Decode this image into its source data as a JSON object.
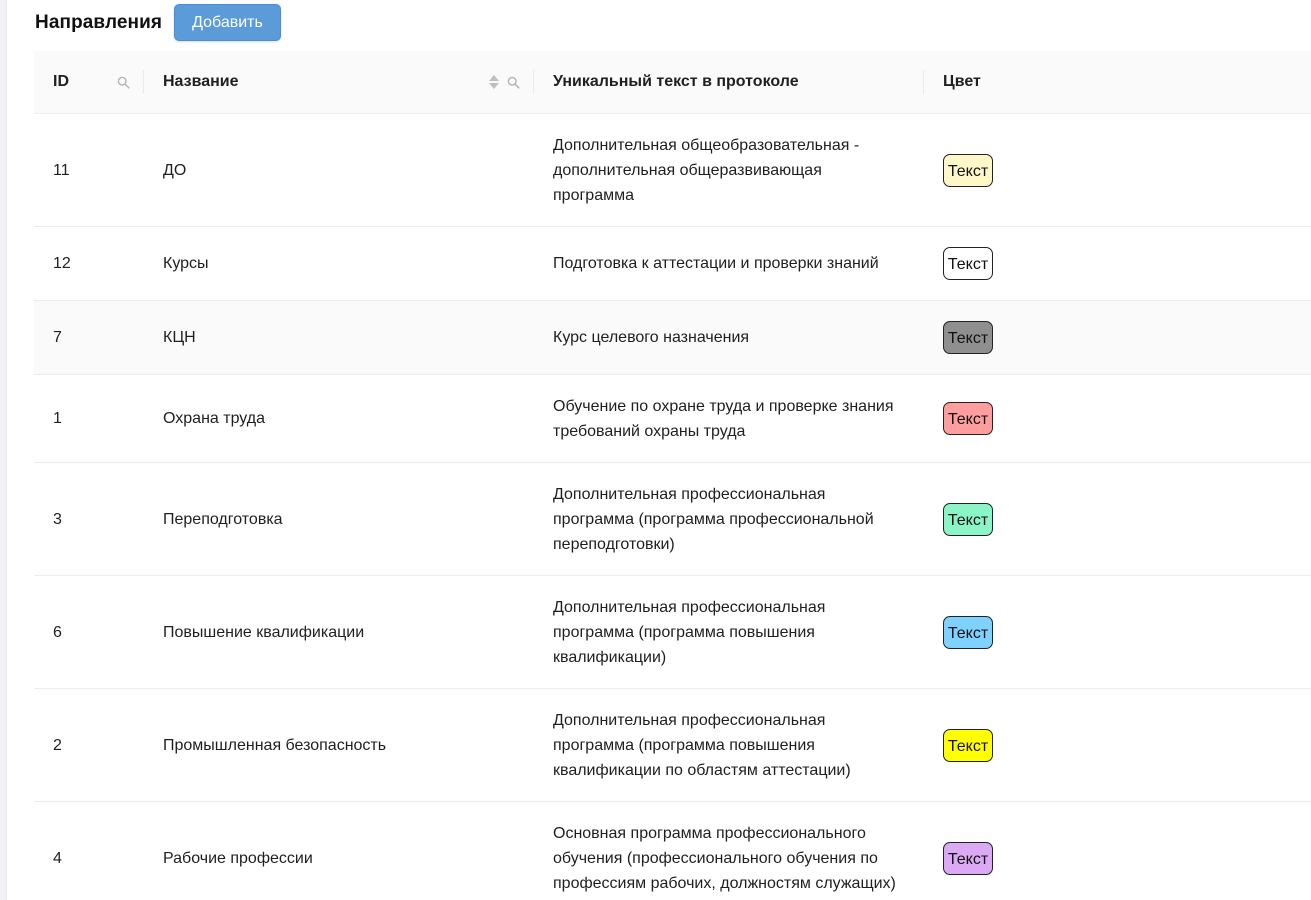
{
  "header": {
    "title": "Направления",
    "add_label": "Добавить"
  },
  "table": {
    "columns": {
      "id": "ID",
      "name": "Название",
      "text": "Уникальный текст в протоколе",
      "color": "Цвет"
    },
    "rows": [
      {
        "id": "11",
        "name": "ДО",
        "text": "Дополнительная общеобразовательная - дополнительная общеразвивающая программа",
        "badge": "Текст",
        "color": "#fff7c8"
      },
      {
        "id": "12",
        "name": "Курсы",
        "text": "Подготовка к аттестации и проверки знаний",
        "badge": "Текст",
        "color": "#ffffff"
      },
      {
        "id": "7",
        "name": "КЦН",
        "text": "Курс целевого назначения",
        "badge": "Текст",
        "color": "#8f8f8f"
      },
      {
        "id": "1",
        "name": "Охрана труда",
        "text": "Обучение по охране труда и проверке знания требований охраны труда",
        "badge": "Текст",
        "color": "#ff9e9e"
      },
      {
        "id": "3",
        "name": "Переподготовка",
        "text": "Дополнительная профессиональная программа (программа профессиональной переподготовки)",
        "badge": "Текст",
        "color": "#8cf5c8"
      },
      {
        "id": "6",
        "name": "Повышение квалификации",
        "text": "Дополнительная профессиональная программа (программа повышения квалификации)",
        "badge": "Текст",
        "color": "#7fd2ff"
      },
      {
        "id": "2",
        "name": "Промышленная безопасность",
        "text": "Дополнительная профессиональная программа (программа повышения квалификации по областям аттестации)",
        "badge": "Текст",
        "color": "#ffff00"
      },
      {
        "id": "4",
        "name": "Рабочие профессии",
        "text": "Основная программа профессионального обучения (профессионального обучения по профессиям рабочих, должностям служащих)",
        "badge": "Текст",
        "color": "#dcaaf5"
      }
    ]
  },
  "icons": {
    "search": "search-icon",
    "sort": "sort-icon"
  }
}
